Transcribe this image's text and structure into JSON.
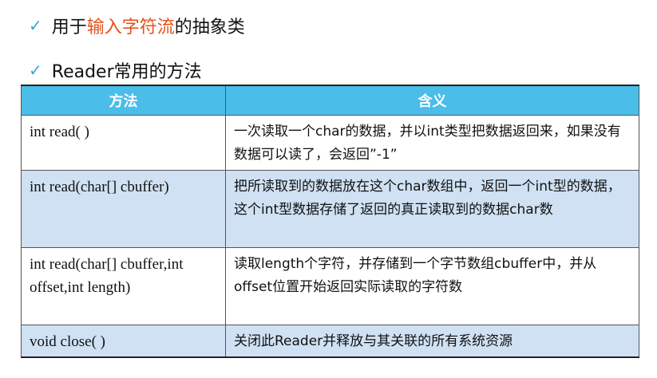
{
  "bullets": [
    {
      "prefix": "用于",
      "highlight": "输入字符流",
      "suffix": "的抽象类"
    },
    {
      "text": "Reader常用的方法"
    }
  ],
  "table": {
    "headers": [
      "方法",
      "含义"
    ],
    "rows": [
      {
        "method": "int  read( )",
        "meaning": "一次读取一个char的数据，并以int类型把数据返回来，如果没有数据可以读了，会返回”-1”"
      },
      {
        "method": "int  read(char[] cbuffer)",
        "meaning": "把所读取到的数据放在这个char数组中，返回一个int型的数据，这个int型数据存储了返回的真正读取到的数据char数"
      },
      {
        "method": "int read(char[] cbuffer,int offset,int length)",
        "meaning": "读取length个字符，并存储到一个字节数组cbuffer中，并从offset位置开始返回实际读取的字符数"
      },
      {
        "method": "void close( )",
        "meaning": "关闭此Reader并释放与其关联的所有系统资源"
      }
    ]
  },
  "colors": {
    "check": "#3aa0d8",
    "highlight": "#e8501d",
    "header_bg": "#4bbde9",
    "alt_row_bg": "#cfe1f3"
  }
}
